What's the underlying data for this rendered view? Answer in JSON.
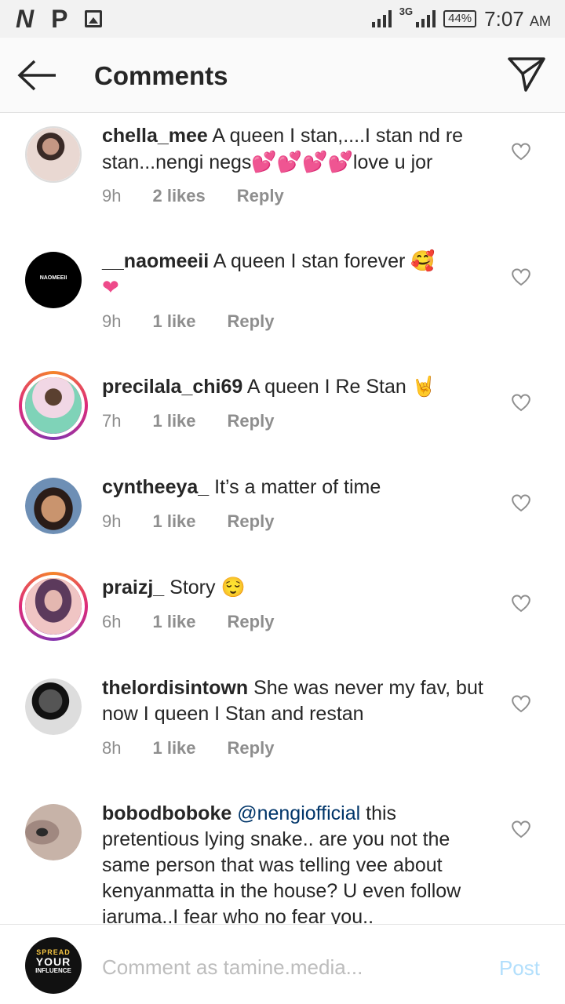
{
  "status_bar": {
    "left_icons": [
      "n-logo-icon",
      "p-logo-icon",
      "image-icon"
    ],
    "n_glyph": "N",
    "p_glyph": "P",
    "network": "3G",
    "battery": "44%",
    "time": "7:07",
    "ampm": "AM"
  },
  "header": {
    "title": "Comments",
    "back_icon": "arrow-left-icon",
    "send_icon": "paper-plane-icon"
  },
  "comments": [
    {
      "username": "chella_mee",
      "text": "A queen I stan,....I stan nd re stan...nengi negs",
      "text_after": "love u jor",
      "emoji_after": "💕💕💕💕",
      "time": "9h",
      "likes": "2 likes",
      "reply": "Reply"
    },
    {
      "username": "__naomeeii",
      "text": "A queen I stan forever",
      "emoji_after": "🥰",
      "line2_emoji": "❤",
      "avatar_text": "NAOMEEII",
      "time": "9h",
      "likes": "1 like",
      "reply": "Reply"
    },
    {
      "username": "precilala_chi69",
      "text": "A queen I Re Stan",
      "emoji_after": "🤘",
      "time": "7h",
      "likes": "1 like",
      "reply": "Reply"
    },
    {
      "username": "cyntheeya_",
      "text": "It’s a matter of time",
      "time": "9h",
      "likes": "1 like",
      "reply": "Reply"
    },
    {
      "username": "praizj_",
      "text": "Story",
      "emoji_after": "😌",
      "time": "6h",
      "likes": "1 like",
      "reply": "Reply"
    },
    {
      "username": "thelordisintown",
      "text": "She was never my fav, but now I queen I Stan and restan",
      "time": "8h",
      "likes": "1 like",
      "reply": "Reply"
    },
    {
      "username": "bobodboboke",
      "mention": "@nengiofficial",
      "text": "this pretentious lying snake.. are you not the same person that was telling vee about kenyanmatta in the house? U even follow iaruma..I fear who no fear you.."
    }
  ],
  "composer": {
    "placeholder": "Comment as tamine.media...",
    "post_label": "Post",
    "avatar_top": "SPREAD",
    "avatar_mid": "YOUR",
    "avatar_bot": "INFLUENCE"
  },
  "colors": {
    "accent_disabled": "#b2dffc",
    "mention": "#003569",
    "meta_gray": "#8e8e8e"
  }
}
